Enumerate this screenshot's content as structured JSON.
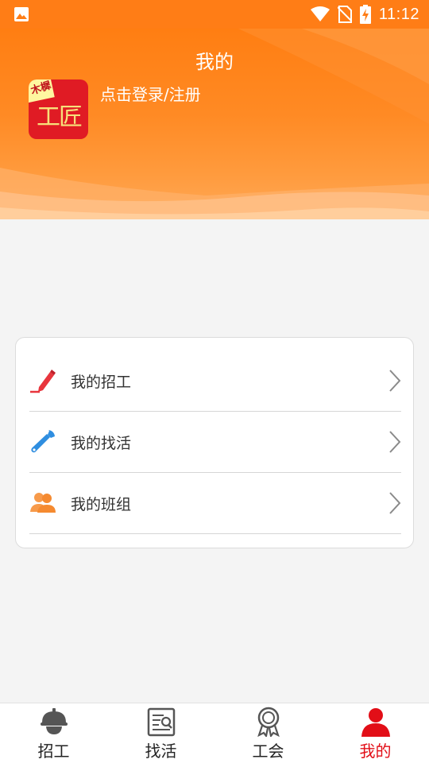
{
  "status_bar": {
    "time": "11:12"
  },
  "header": {
    "title": "我的",
    "login_text": "点击登录/注册"
  },
  "app_logo": {
    "main_text": "工匠",
    "corner_text": "木樨"
  },
  "menu": {
    "items": [
      {
        "label": "我的招工",
        "icon": "pencil-icon"
      },
      {
        "label": "我的找活",
        "icon": "wrench-icon"
      },
      {
        "label": "我的班组",
        "icon": "group-icon"
      }
    ]
  },
  "tabbar": {
    "items": [
      {
        "label": "招工",
        "icon": "hardhat-icon"
      },
      {
        "label": "找活",
        "icon": "document-search-icon"
      },
      {
        "label": "工会",
        "icon": "award-icon"
      },
      {
        "label": "我的",
        "icon": "person-icon",
        "active": true
      }
    ]
  },
  "colors": {
    "accent": "#ff7d16",
    "active_tab": "#e20e17"
  }
}
